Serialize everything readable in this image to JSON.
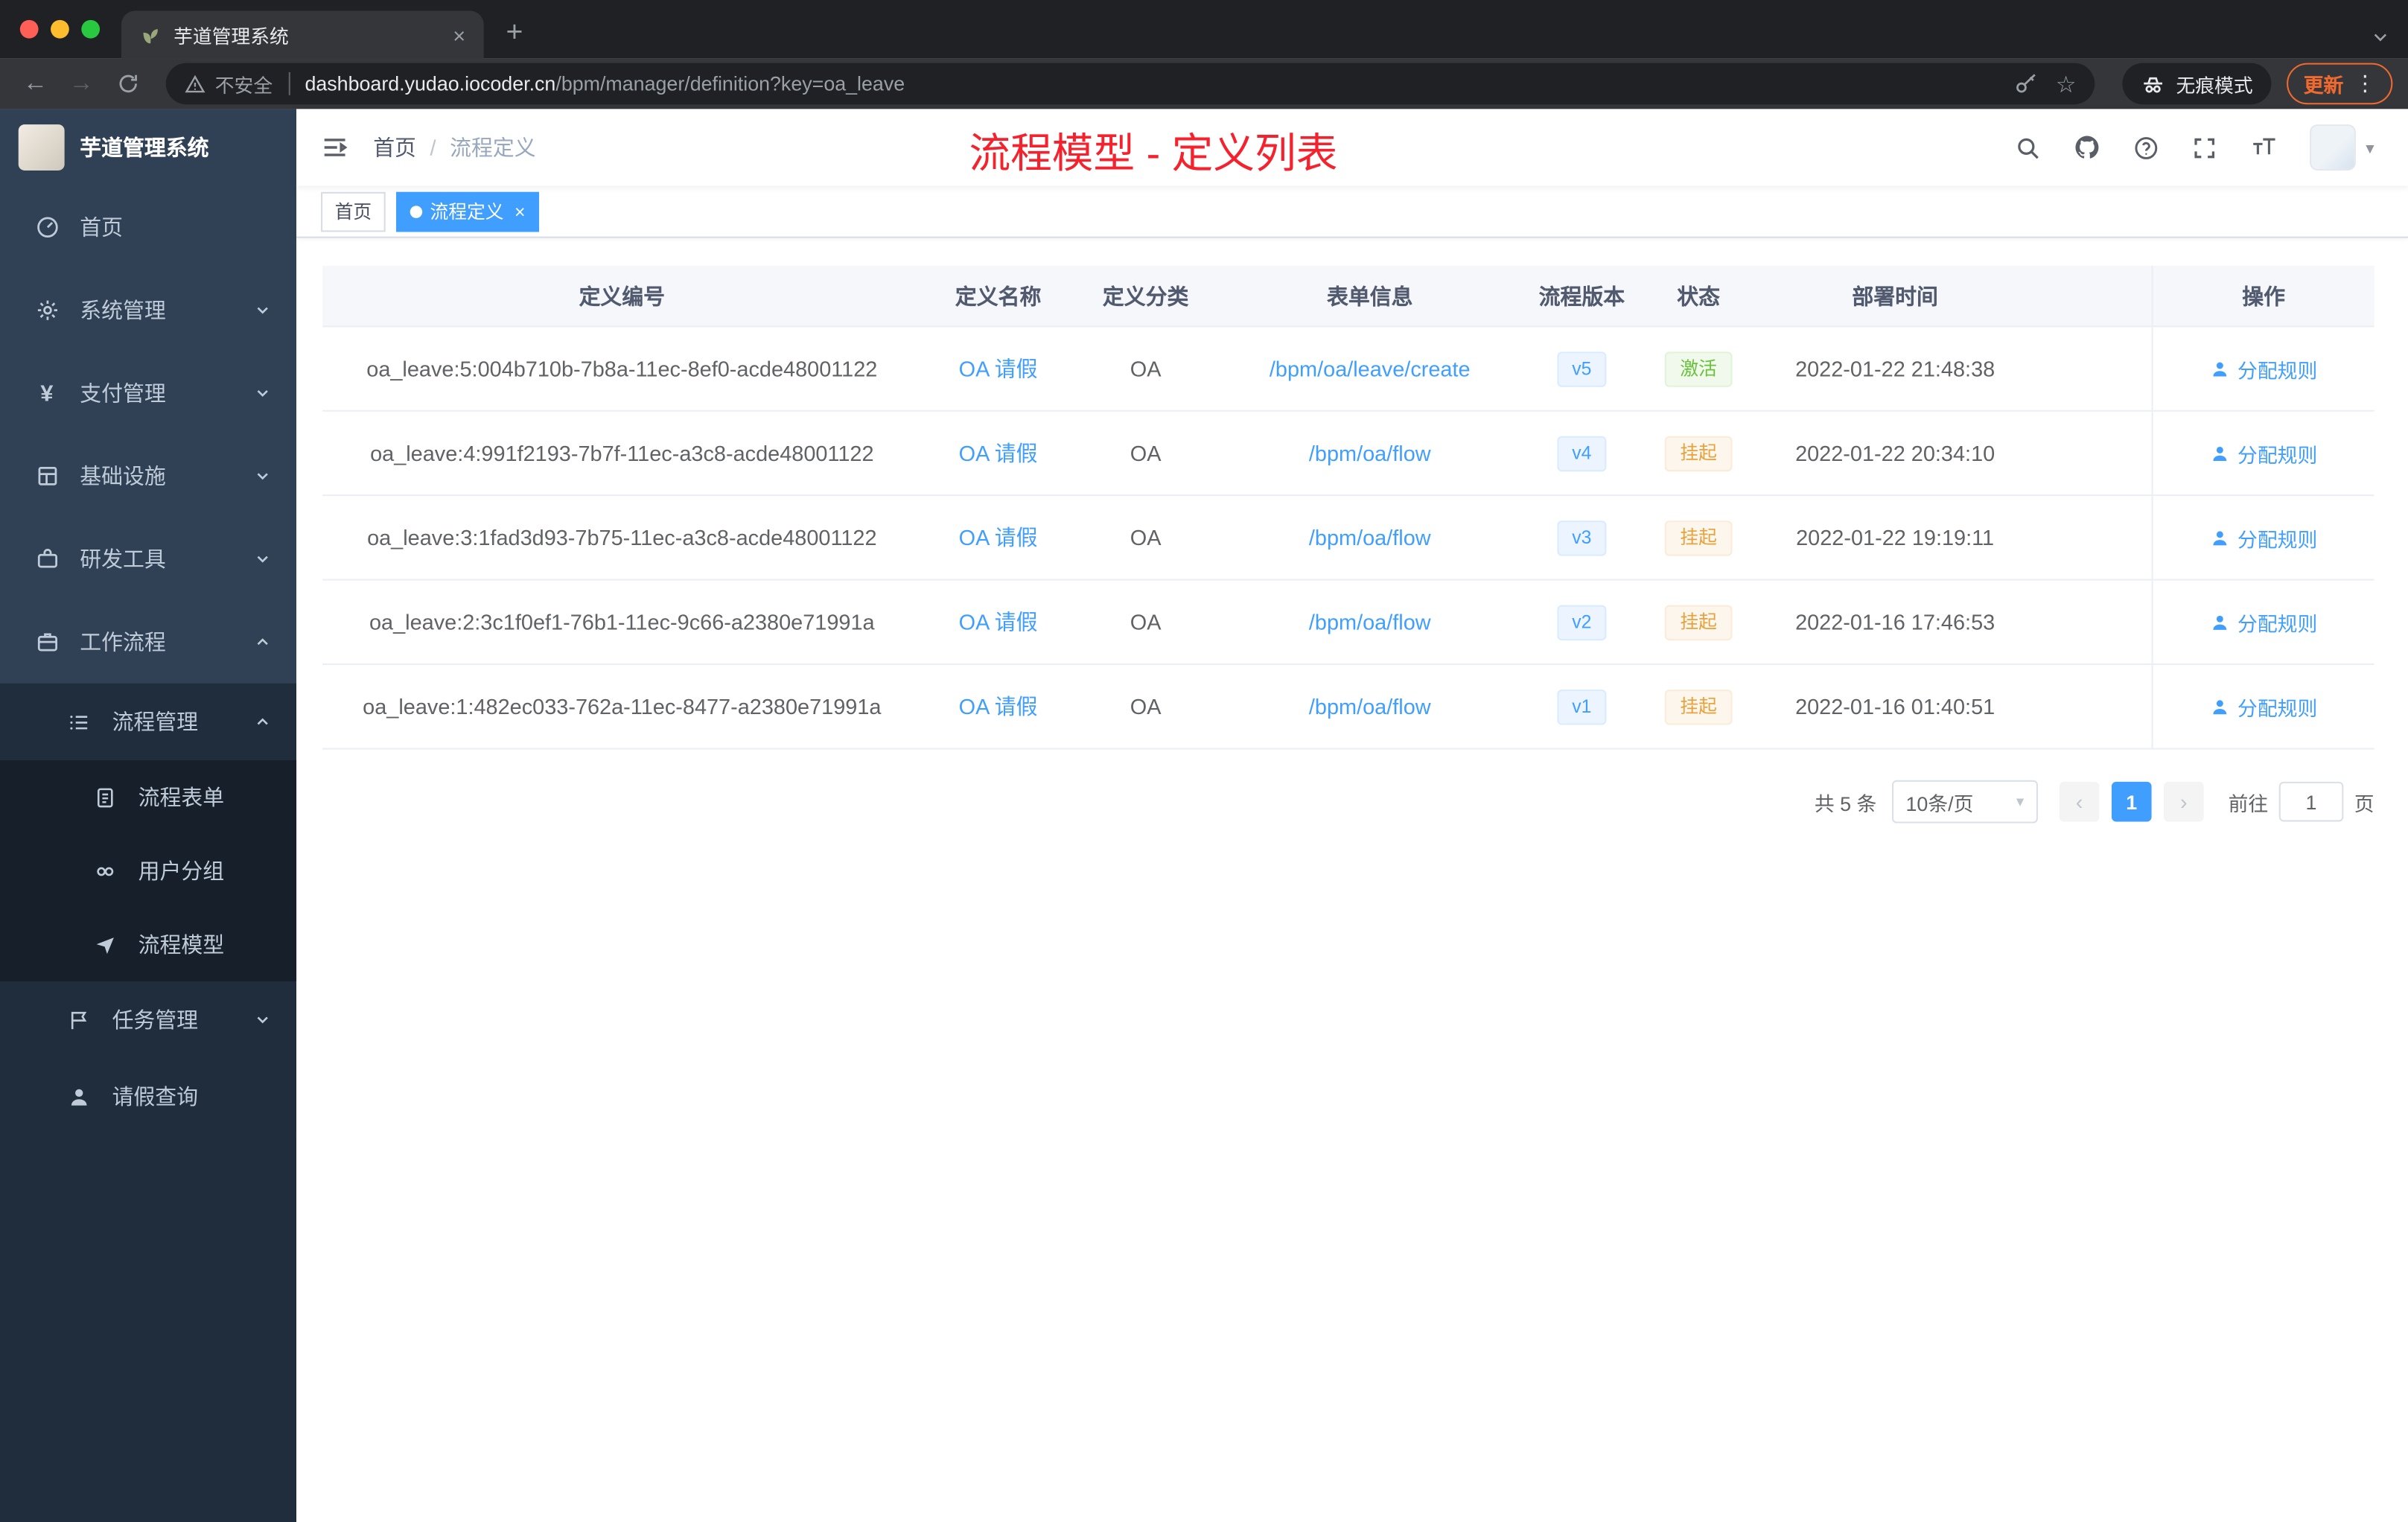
{
  "browser": {
    "tab_title": "芋道管理系统",
    "security_label": "不安全",
    "url_host": "dashboard.yudao.iocoder.cn",
    "url_path": "/bpm/manager/definition?key=oa_leave",
    "incognito_label": "无痕模式",
    "update_label": "更新"
  },
  "sidebar": {
    "logo_title": "芋道管理系统",
    "items": [
      {
        "label": "首页"
      },
      {
        "label": "系统管理"
      },
      {
        "label": "支付管理"
      },
      {
        "label": "基础设施"
      },
      {
        "label": "研发工具"
      },
      {
        "label": "工作流程"
      }
    ],
    "submenu": {
      "process_management": "流程管理",
      "children": [
        "流程表单",
        "用户分组",
        "流程模型"
      ],
      "task_management": "任务管理",
      "leave_query": "请假查询"
    }
  },
  "header": {
    "breadcrumb": {
      "home": "首页",
      "separator": "/",
      "current": "流程定义"
    },
    "annotation": "流程模型 - 定义列表"
  },
  "tags": {
    "home": "首页",
    "active": "流程定义"
  },
  "table": {
    "columns": [
      "定义编号",
      "定义名称",
      "定义分类",
      "表单信息",
      "流程版本",
      "状态",
      "部署时间",
      "操作"
    ],
    "rows": [
      {
        "id": "oa_leave:5:004b710b-7b8a-11ec-8ef0-acde48001122",
        "name": "OA 请假",
        "category": "OA",
        "form": "/bpm/oa/leave/create",
        "version": "v5",
        "status": "激活",
        "status_type": "success",
        "time": "2022-01-22 21:48:38",
        "action": "分配规则"
      },
      {
        "id": "oa_leave:4:991f2193-7b7f-11ec-a3c8-acde48001122",
        "name": "OA 请假",
        "category": "OA",
        "form": "/bpm/oa/flow",
        "version": "v4",
        "status": "挂起",
        "status_type": "warning",
        "time": "2022-01-22 20:34:10",
        "action": "分配规则"
      },
      {
        "id": "oa_leave:3:1fad3d93-7b75-11ec-a3c8-acde48001122",
        "name": "OA 请假",
        "category": "OA",
        "form": "/bpm/oa/flow",
        "version": "v3",
        "status": "挂起",
        "status_type": "warning",
        "time": "2022-01-22 19:19:11",
        "action": "分配规则"
      },
      {
        "id": "oa_leave:2:3c1f0ef1-76b1-11ec-9c66-a2380e71991a",
        "name": "OA 请假",
        "category": "OA",
        "form": "/bpm/oa/flow",
        "version": "v2",
        "status": "挂起",
        "status_type": "warning",
        "time": "2022-01-16 17:46:53",
        "action": "分配规则"
      },
      {
        "id": "oa_leave:1:482ec033-762a-11ec-8477-a2380e71991a",
        "name": "OA 请假",
        "category": "OA",
        "form": "/bpm/oa/flow",
        "version": "v1",
        "status": "挂起",
        "status_type": "warning",
        "time": "2022-01-16 01:40:51",
        "action": "分配规则"
      }
    ]
  },
  "pagination": {
    "total": "共 5 条",
    "page_size": "10条/页",
    "page": "1",
    "goto_label": "前往",
    "goto_value": "1",
    "page_unit": "页"
  },
  "colors": {
    "accent": "#409eff",
    "success": "#67c23a",
    "warning": "#e6a23c",
    "annotation_red": "#f5222d",
    "update_orange": "#f06a2f",
    "sidebar_bg": "#304156",
    "submenu_bg": "#1f2d3d"
  }
}
